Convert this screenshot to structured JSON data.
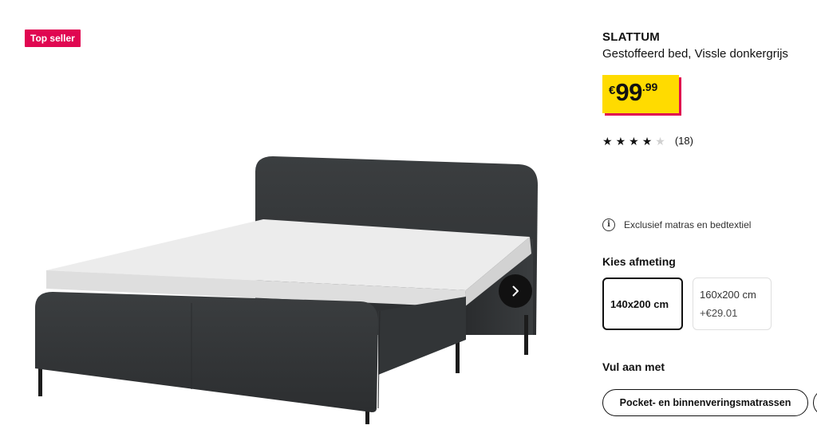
{
  "gallery": {
    "badge": "Top seller",
    "next_icon": "chevron-right-icon"
  },
  "product": {
    "name": "SLATTUM",
    "description": "Gestoffeerd bed, Vissle donkergrijs"
  },
  "price": {
    "currency": "€",
    "integer": "99",
    "decimals": ".99",
    "tag_color": "#ffdb00",
    "shadow_color": "#e00751"
  },
  "rating": {
    "stars_filled": 4,
    "stars_total": 5,
    "review_count": "(18)"
  },
  "info": {
    "icon": "info-icon",
    "text": "Exclusief matras en bedtextiel"
  },
  "size": {
    "heading": "Kies afmeting",
    "options": [
      {
        "label": "140x200 cm",
        "extra": "",
        "selected": true
      },
      {
        "label": "160x200 cm",
        "extra": "+€29.01",
        "selected": false
      }
    ]
  },
  "complement": {
    "heading": "Vul aan met",
    "pills": [
      "Pocket- en binnenveringsmatrassen",
      ""
    ]
  },
  "colors": {
    "badge": "#e00751",
    "text": "#111111",
    "bed_fabric": "#35383a"
  }
}
